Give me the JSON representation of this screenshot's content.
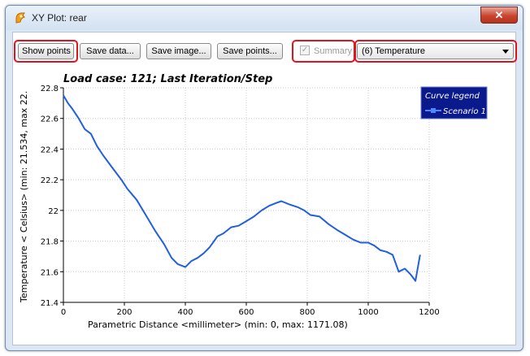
{
  "window": {
    "title": "XY Plot: rear",
    "close_label": "✕"
  },
  "toolbar": {
    "show_points": "Show points",
    "save_data": "Save data...",
    "save_image": "Save image...",
    "save_points": "Save points...",
    "summary": "Summary",
    "summary_checked": true,
    "summary_enabled": false,
    "result_select": "(6) Temperature"
  },
  "colors": {
    "highlight": "#e0131f",
    "curve": "#1f5fe0",
    "legend_bg": "#0a1a8c"
  },
  "chart_data": {
    "type": "line",
    "title": "Load case: 121; Last Iteration/Step",
    "xlabel": "Parametric Distance  <millimeter>  (min: 0, max: 1171.08)",
    "ylabel": "Temperature < Celsius> (min: 21.534, max 22.",
    "xlim": [
      0,
      1200
    ],
    "ylim": [
      21.4,
      22.8
    ],
    "xticks": [
      "0",
      "200",
      "400",
      "600",
      "800",
      "1000",
      "1200"
    ],
    "yticks": [
      "21.4",
      "21.6",
      "21.8",
      "22",
      "22.2",
      "22.4",
      "22.6",
      "22.8"
    ],
    "grid": true,
    "legend": {
      "title": "Curve legend",
      "placement": "top-right"
    },
    "series": [
      {
        "name": "Scenario 1",
        "x": [
          0,
          15,
          30,
          50,
          70,
          90,
          110,
          130,
          160,
          190,
          210,
          240,
          270,
          300,
          330,
          355,
          375,
          400,
          420,
          440,
          460,
          480,
          505,
          525,
          550,
          575,
          600,
          625,
          650,
          675,
          700,
          715,
          740,
          770,
          790,
          810,
          840,
          870,
          900,
          925,
          950,
          975,
          1000,
          1020,
          1040,
          1060,
          1080,
          1100,
          1120,
          1140,
          1155,
          1170
        ],
        "y": [
          22.75,
          22.7,
          22.66,
          22.6,
          22.53,
          22.5,
          22.42,
          22.36,
          22.28,
          22.2,
          22.14,
          22.07,
          21.97,
          21.87,
          21.78,
          21.69,
          21.65,
          21.63,
          21.67,
          21.69,
          21.72,
          21.76,
          21.83,
          21.85,
          21.89,
          21.9,
          21.93,
          21.96,
          22.0,
          22.03,
          22.05,
          22.06,
          22.04,
          22.02,
          22.0,
          21.97,
          21.96,
          21.91,
          21.87,
          21.84,
          21.81,
          21.79,
          21.79,
          21.77,
          21.74,
          21.73,
          21.71,
          21.6,
          21.62,
          21.58,
          21.54,
          21.71
        ]
      }
    ]
  }
}
